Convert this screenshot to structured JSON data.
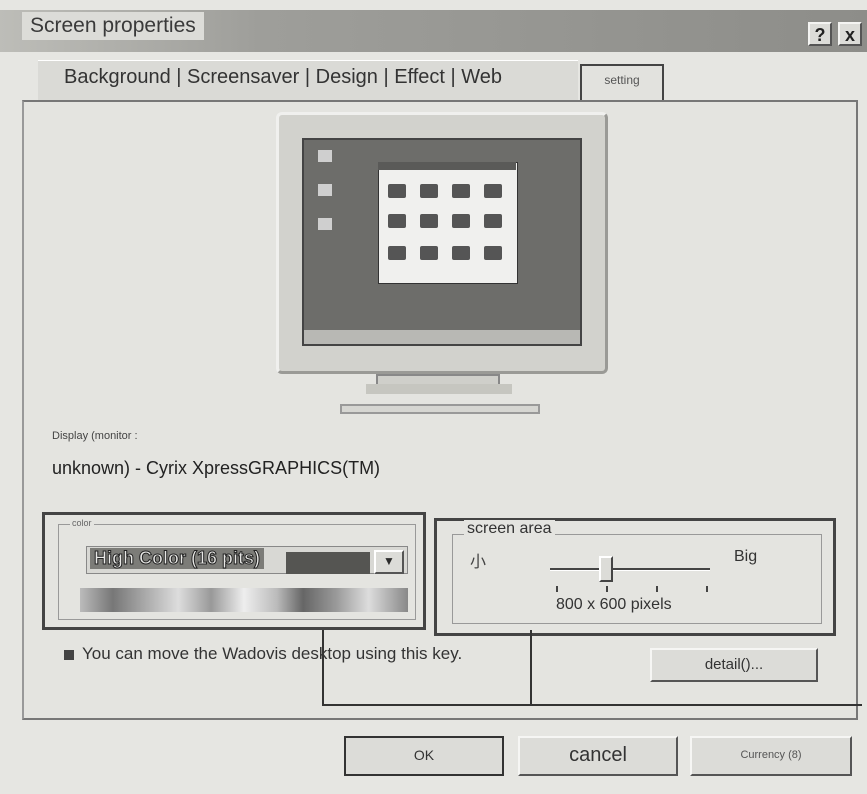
{
  "window": {
    "title": "Screen properties",
    "help_label": "?",
    "close_label": "x"
  },
  "tabs": {
    "labels": "Background | Screensaver | Design | Effect | Web",
    "active": "setting"
  },
  "display": {
    "label": "Display (monitor",
    "label_suffix": ":",
    "value": "unknown) - Cyrix XpressGRAPHICS(TM)"
  },
  "color": {
    "legend": "color",
    "selected": "High Color (16 pits)"
  },
  "screen_area": {
    "legend": "screen area",
    "small_label": "小",
    "big_label": "Big",
    "value": "800 x 600 pixels",
    "slider_position": 0.35
  },
  "note": "You can move the Wadovis desktop using this key.",
  "buttons": {
    "detail": "detail()...",
    "ok": "OK",
    "cancel": "cancel",
    "apply": "Currency (8)"
  },
  "monitor_preview": {
    "desktop_icons": [
      "doc-icon",
      "doc-icon",
      "doc-icon"
    ],
    "window_icons": [
      "app-icon",
      "app-icon",
      "app-icon",
      "app-icon",
      "app-icon",
      "app-icon",
      "app-icon",
      "app-icon",
      "app-icon",
      "app-icon",
      "app-icon",
      "app-icon"
    ]
  }
}
